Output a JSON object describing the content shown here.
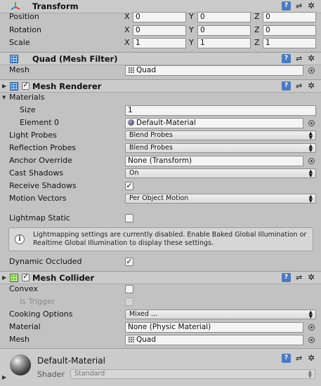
{
  "transform": {
    "title": "Transform",
    "rows": [
      {
        "label": "Position",
        "x": "0",
        "y": "0",
        "z": "0"
      },
      {
        "label": "Rotation",
        "x": "0",
        "y": "0",
        "z": "0"
      },
      {
        "label": "Scale",
        "x": "1",
        "y": "1",
        "z": "1"
      }
    ],
    "axis_x": "X",
    "axis_y": "Y",
    "axis_z": "Z"
  },
  "mesh_filter": {
    "title": "Quad (Mesh Filter)",
    "mesh_label": "Mesh",
    "mesh_value": "Quad"
  },
  "mesh_renderer": {
    "title": "Mesh Renderer",
    "materials_label": "Materials",
    "size_label": "Size",
    "size_value": "1",
    "element0_label": "Element 0",
    "element0_value": "Default-Material",
    "light_probes_label": "Light Probes",
    "light_probes_value": "Blend Probes",
    "reflection_probes_label": "Reflection Probes",
    "reflection_probes_value": "Blend Probes",
    "anchor_override_label": "Anchor Override",
    "anchor_override_value": "None (Transform)",
    "cast_shadows_label": "Cast Shadows",
    "cast_shadows_value": "On",
    "receive_shadows_label": "Receive Shadows",
    "receive_shadows_checked": true,
    "motion_vectors_label": "Motion Vectors",
    "motion_vectors_value": "Per Object Motion",
    "lightmap_static_label": "Lightmap Static",
    "lightmap_static_checked": false,
    "info_text": "Lightmapping settings are currently disabled. Enable Baked Global Illumination or Realtime Global Illumination to display these settings.",
    "dynamic_occluded_label": "Dynamic Occluded",
    "dynamic_occluded_checked": true
  },
  "mesh_collider": {
    "title": "Mesh Collider",
    "convex_label": "Convex",
    "convex_checked": false,
    "is_trigger_label": "Is Trigger",
    "is_trigger_checked": false,
    "cooking_options_label": "Cooking Options",
    "cooking_options_value": "Mixed ...",
    "material_label": "Material",
    "material_value": "None (Physic Material)",
    "mesh_label": "Mesh",
    "mesh_value": "Quad"
  },
  "material_preview": {
    "name": "Default-Material",
    "shader_label": "Shader",
    "shader_value": "Standard"
  },
  "glyphs": {
    "check": "✓",
    "help": "?",
    "preset": "⇌",
    "gear": "✲",
    "fold": "▶",
    "arrows": "▲▼",
    "info": "i"
  },
  "colors": {
    "panel": "#c2c2c2",
    "header": "#cbcbcb",
    "help_blue": "#4b7ac0"
  }
}
